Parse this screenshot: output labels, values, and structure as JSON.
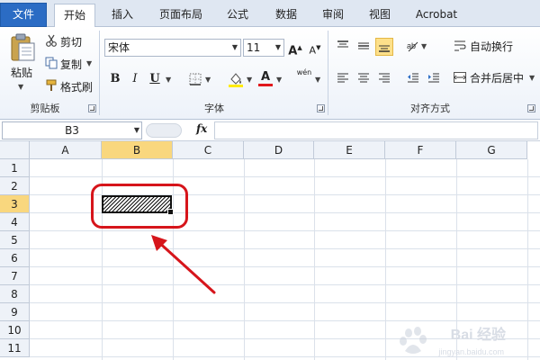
{
  "tabs": {
    "file": "文件",
    "home": "开始",
    "insert": "插入",
    "page_layout": "页面布局",
    "formulas": "公式",
    "data": "数据",
    "review": "审阅",
    "view": "视图",
    "acrobat": "Acrobat"
  },
  "clipboard": {
    "paste": "粘贴",
    "cut": "剪切",
    "copy": "复制",
    "format_painter": "格式刷",
    "group_label": "剪贴板"
  },
  "font": {
    "name": "宋体",
    "size": "11",
    "grow": "A",
    "shrink": "A",
    "bold": "B",
    "italic": "I",
    "underline": "U",
    "font_color_glyph": "A",
    "phonetic_glyph": "wén",
    "group_label": "字体"
  },
  "alignment": {
    "wrap_text": "自动换行",
    "merge_center": "合并后居中",
    "group_label": "对齐方式"
  },
  "formula_bar": {
    "name_box": "B3",
    "fx": "fx",
    "value": ""
  },
  "grid": {
    "columns": [
      "A",
      "B",
      "C",
      "D",
      "E",
      "F",
      "G"
    ],
    "rows": [
      "1",
      "2",
      "3",
      "4",
      "5",
      "6",
      "7",
      "8",
      "9",
      "10",
      "11"
    ],
    "selected_column": "B",
    "selected_row": "3"
  },
  "watermark": {
    "text": "Bai 经验",
    "sub": "jingyan.baidu.com"
  },
  "colors": {
    "accent": "#2b6cc4",
    "selection_header": "#f9d77e",
    "annotation_red": "#d6151b"
  }
}
